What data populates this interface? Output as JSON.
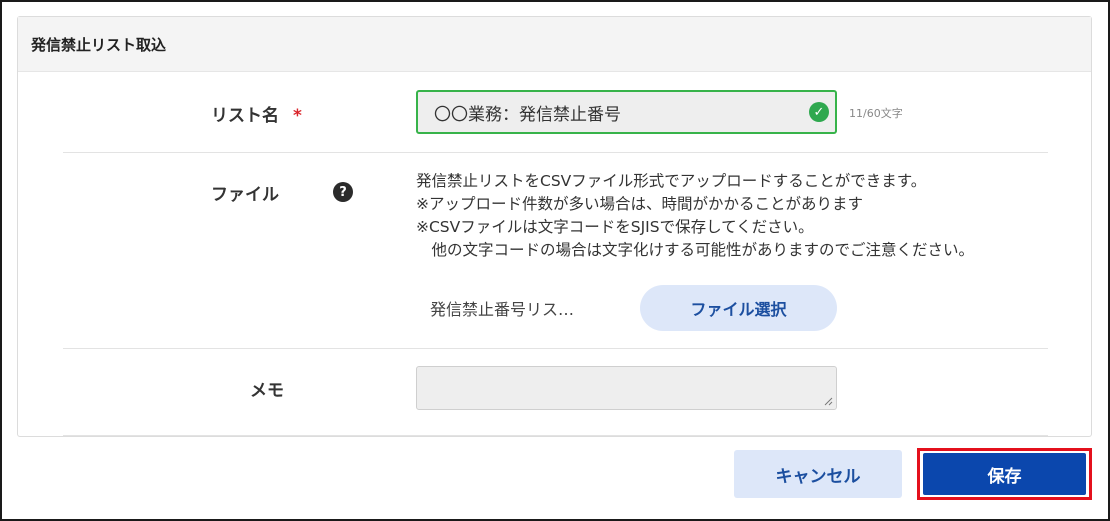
{
  "panel": {
    "title": "発信禁止リスト取込"
  },
  "form": {
    "list_name": {
      "label": "リスト名",
      "required_mark": "*",
      "value": "〇〇業務：発信禁止番号",
      "counter": "11/60文字"
    },
    "file": {
      "label": "ファイル",
      "help_icon_glyph": "?",
      "description": [
        "発信禁止リストをCSVファイル形式でアップロードすることができます。",
        "※アップロード件数が多い場合は、時間がかかることがあります",
        "※CSVファイルは文字コードをSJISで保存してください。",
        "　他の文字コードの場合は文字化けする可能性がありますのでご注意ください。"
      ],
      "selected_file": "発信禁止番号リス…",
      "select_button": "ファイル選択"
    },
    "memo": {
      "label": "メモ",
      "value": ""
    }
  },
  "actions": {
    "cancel_label": "キャンセル",
    "save_label": "保存"
  },
  "colors": {
    "valid_border": "#37b34a",
    "required_mark": "#d9262c",
    "primary": "#0b47ad",
    "secondary_bg": "#dde7f9",
    "highlight_outline": "#e4101c"
  }
}
